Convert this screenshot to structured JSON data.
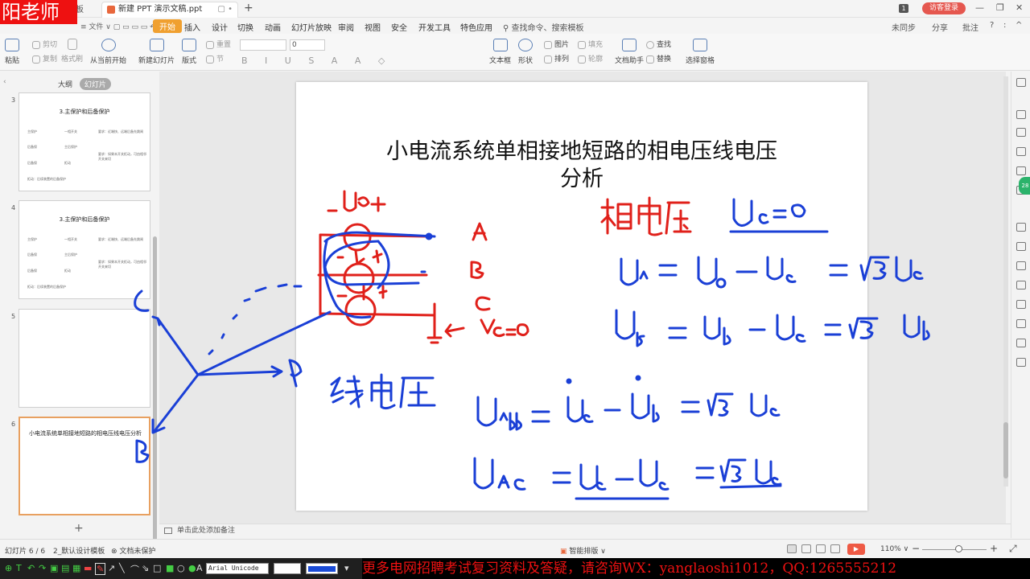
{
  "watermark": "阳老师",
  "titlebar": {
    "home_tab": "板",
    "document_tab": "新建 PPT 演示文稿.ppt",
    "tab_controls": "▢ •",
    "new_tab": "+",
    "page_badge": "1",
    "login_button": "访客登录",
    "minimize": "—",
    "restore": "❐",
    "close": "✕"
  },
  "menu": {
    "items": [
      "开始",
      "插入",
      "设计",
      "切换",
      "动画",
      "幻灯片放映",
      "审阅",
      "视图",
      "安全",
      "开发工具",
      "特色应用"
    ],
    "active": "开始",
    "search": "查找命令、搜索模板",
    "right": [
      "未同步",
      "分享",
      "批注",
      "?",
      ":",
      "^"
    ],
    "file_shortcuts": "≡ 文件 ∨ ▢ ▭ ▭ ▭ ↶ · ↷ · ∨"
  },
  "ribbon": {
    "paste": "粘贴",
    "cut": "剪切",
    "copy": "复制",
    "format_painter": "格式刷",
    "from_current": "从当前开始",
    "new_slide": "新建幻灯片",
    "layout": "版式",
    "reset": "重置",
    "section": "节",
    "font_size": "0",
    "text_box": "文本框",
    "shape": "形状",
    "picture": "图片",
    "arrange": "排列",
    "fill": "填充",
    "outline": "轮廓",
    "doc_helper": "文档助手",
    "find": "查找",
    "replace": "替换",
    "select_pane": "选择窗格",
    "format_buttons": "B I U S A A ◇"
  },
  "panel": {
    "tab_outline": "大纲",
    "tab_slides": "幻灯片",
    "collapse": "‹",
    "add_slide": "+"
  },
  "slides": [
    {
      "number": "3",
      "title": "3.主保护和后备保护",
      "cells": [
        "主保护",
        "一相开关",
        "要求：近端快、远端后备先跳闸",
        "后备保",
        "主后保护",
        "",
        "后备保",
        "拒动",
        "要求：如果本开关拒动，可由相邻开关来切",
        "拒动：后续装置的后备保护"
      ]
    },
    {
      "number": "4",
      "title": "3.主保护和后备保护",
      "cells": [
        "主保护",
        "一相开关",
        "要求：近端快、远端后备先跳闸",
        "后备保",
        "主后保护",
        "",
        "后备保",
        "拒动",
        "要求：如果本开关拒动，可由相邻开关来切",
        "拒动：后续装置的后备保护"
      ]
    },
    {
      "number": "5",
      "title": ""
    },
    {
      "number": "6",
      "title": "小电流系统单相接地短路的相电压线电压分析"
    }
  ],
  "current_slide": {
    "title_line1": "小电流系统单相接地短路的相电压线电压",
    "title_line2": "分析"
  },
  "notes_placeholder": "单击此处添加备注",
  "status": {
    "slide_counter": "幻灯片 6 / 6",
    "template": "2_默认设计模板",
    "protection": "文档未保护",
    "smart_layout": "智能排版",
    "zoom": "110%",
    "zoom_minus": "−",
    "zoom_plus": "+"
  },
  "drawtool": {
    "font_select": "Arial Unicode MS",
    "icons": [
      "text-tool",
      "pen-tool",
      "arrow-tool",
      "rect-tool",
      "ellipse-tool",
      "highlighter-tool",
      "eraser-tool",
      "line-tool",
      "arrow-line-tool",
      "polygon-tool",
      "fill-tool"
    ]
  },
  "ad_banner": "更多电网招聘考试复习资料及答疑，请咨询WX：yanglaoshi1012，QQ:1265555212",
  "colors": {
    "accent_orange": "#f0a030",
    "ink_blue": "#1a3fd6",
    "ink_red": "#e0201a",
    "ad_red": "#ee1111",
    "watermark_red": "#ee1111"
  }
}
